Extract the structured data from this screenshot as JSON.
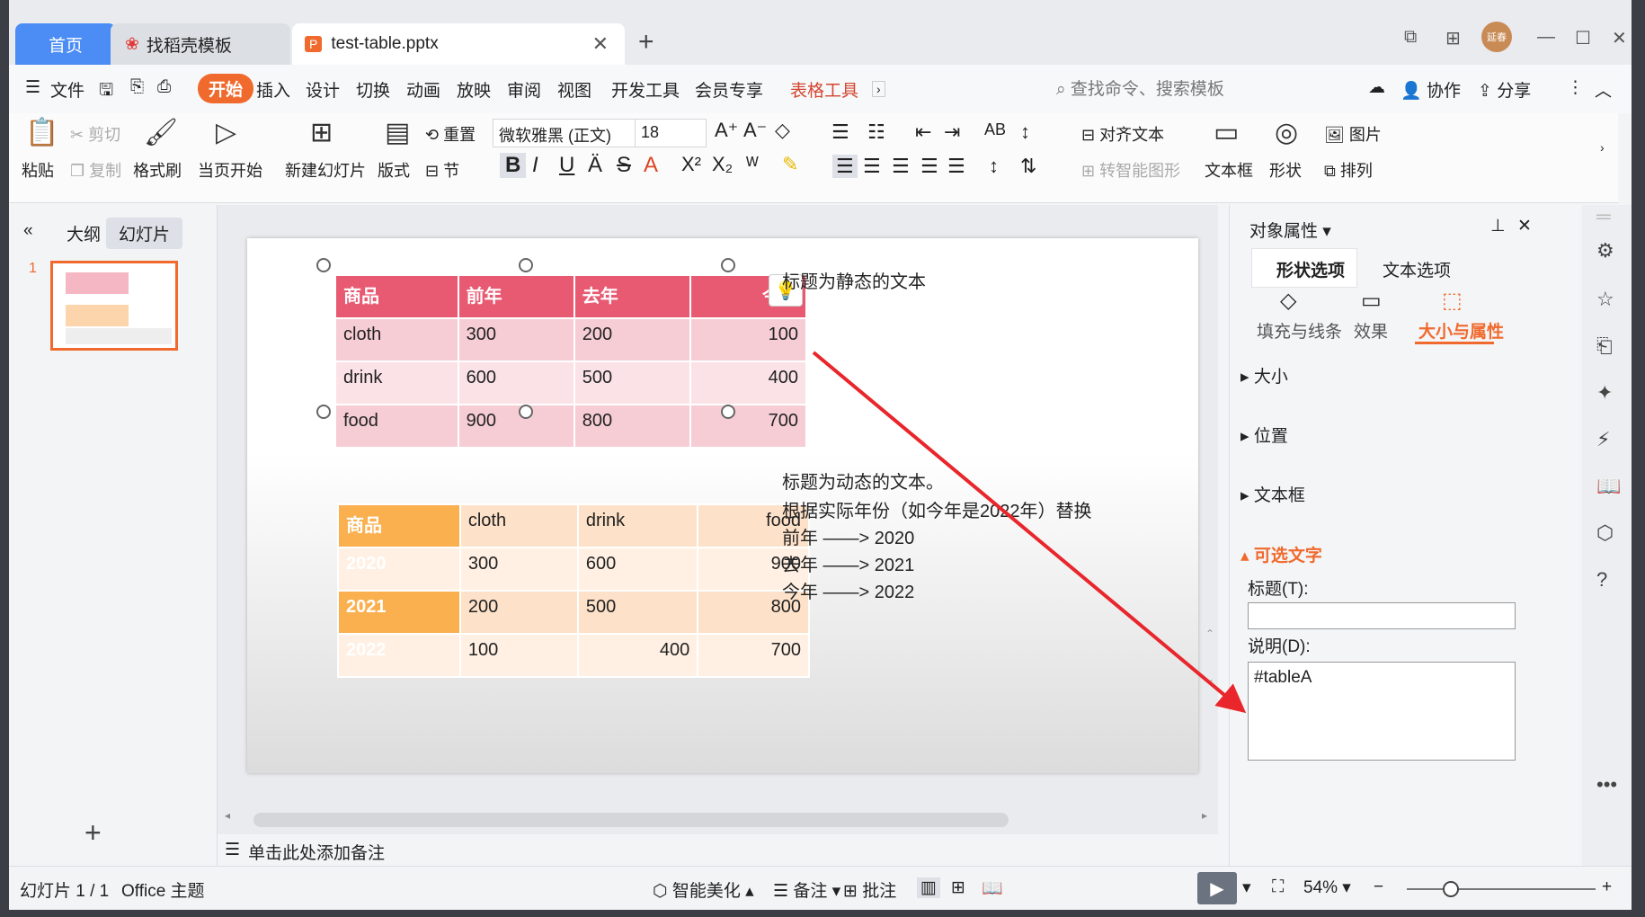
{
  "tabs": {
    "home": "首页",
    "template": "找稻壳模板",
    "file": "test-table.pptx"
  },
  "menu": {
    "file": "文件",
    "start": "开始",
    "insert": "插入",
    "design": "设计",
    "switch": "切换",
    "animate": "动画",
    "play": "放映",
    "review": "审阅",
    "view": "视图",
    "dev": "开发工具",
    "member": "会员专享",
    "table_tools": "表格工具",
    "search_placeholder": "查找命令、搜索模板",
    "collab": "协作",
    "share": "分享"
  },
  "user": {
    "avatar_text": "延春"
  },
  "ribbon": {
    "paste": "粘贴",
    "cut": "剪切",
    "copy": "复制",
    "format_painter": "格式刷",
    "from_current": "当页开始",
    "new_slide": "新建幻灯片",
    "layout": "版式",
    "reset": "重置",
    "section": "节",
    "font_name": "微软雅黑 (正文)",
    "font_size": "18",
    "align_text": "对齐文本",
    "convert_smart": "转智能图形",
    "textbox": "文本框",
    "shape": "形状",
    "picture": "图片",
    "arrange": "排列"
  },
  "left_panel": {
    "outline": "大纲",
    "slides": "幻灯片",
    "slide_number": "1"
  },
  "table_a": {
    "header": [
      "商品",
      "前年",
      "去年",
      "今年"
    ],
    "rows": [
      [
        "cloth",
        "300",
        "200",
        "100"
      ],
      [
        "drink",
        "600",
        "500",
        "400"
      ],
      [
        "food",
        "900",
        "800",
        "700"
      ]
    ]
  },
  "table_b": {
    "header": [
      "商品",
      "cloth",
      "drink",
      "food"
    ],
    "rows": [
      [
        "2020",
        "300",
        "600",
        "900"
      ],
      [
        "2021",
        "200",
        "500",
        "800"
      ],
      [
        "2022",
        "100",
        "400",
        "700"
      ]
    ]
  },
  "notes": {
    "static_title": "标题为静态的文本",
    "dynamic_lines": [
      "标题为动态的文本。",
      "根据实际年份（如今年是2022年）替换",
      "前年 ——> 2020",
      "去年 ——> 2021",
      "今年 ——> 2022"
    ]
  },
  "add_notes": "单击此处添加备注",
  "right_panel": {
    "title": "对象属性",
    "tab_shape": "形状选项",
    "tab_text": "文本选项",
    "sub_fill": "填充与线条",
    "sub_effect": "效果",
    "sub_size": "大小与属性",
    "sec_size": "大小",
    "sec_position": "位置",
    "sec_textbox": "文本框",
    "sec_alt": "可选文字",
    "label_title": "标题(T):",
    "title_value": "",
    "label_desc": "说明(D):",
    "desc_value": "#tableA"
  },
  "status": {
    "slide_info": "幻灯片 1 / 1",
    "theme": "Office 主题",
    "beautify": "智能美化",
    "notes": "备注",
    "comment": "批注",
    "zoom": "54%"
  },
  "colors": {
    "accent": "#f06a2e",
    "tableA_head": "#e85a72",
    "tableB_head": "#fbb04f",
    "arrow": "#e8262b"
  }
}
